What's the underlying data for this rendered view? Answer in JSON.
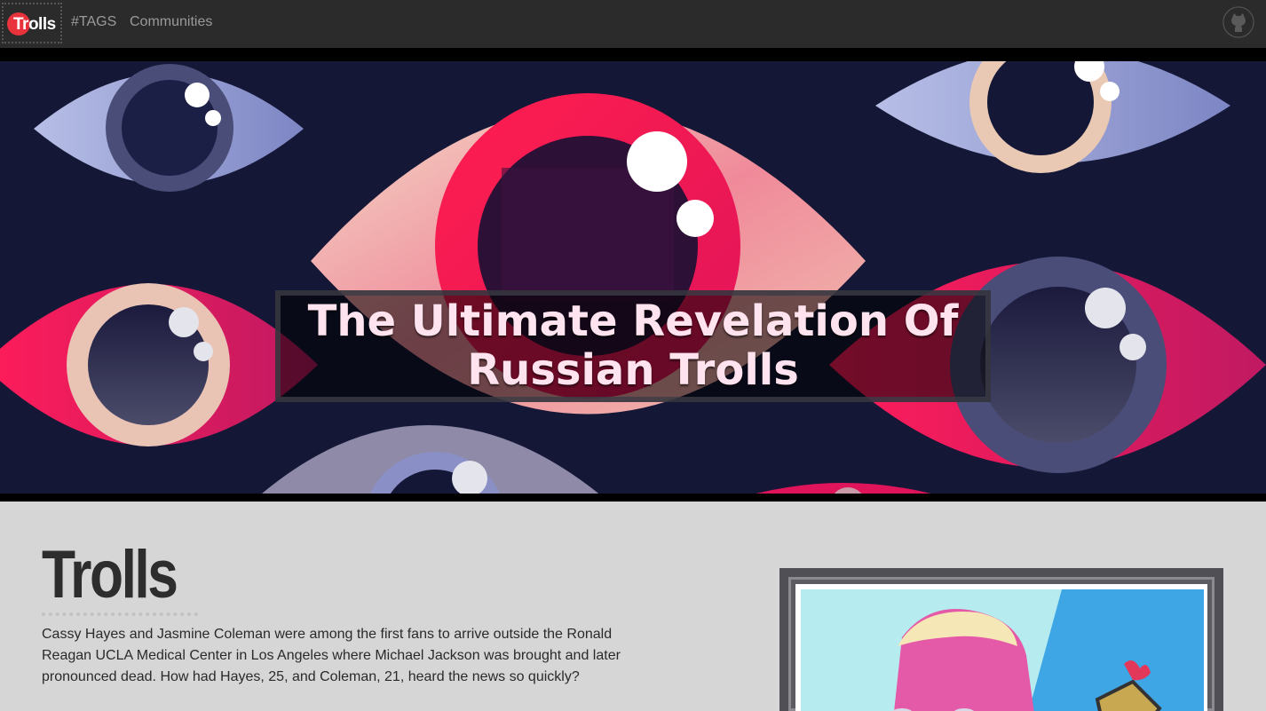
{
  "navbar": {
    "brand": "Trolls",
    "links": [
      "#TAGS",
      "Communities"
    ],
    "github_icon": "github-icon"
  },
  "hero": {
    "title": "The Ultimate Revelation Of Russian Trolls"
  },
  "content": {
    "title": "Trolls",
    "intro": "Cassy Hayes and Jasmine Coleman were among the first fans to arrive outside the Ronald Reagan UCLA Medical Center in Los Angeles where Michael Jackson was brought and later pronounced dead. How had Hayes, 25, and Coleman, 21, heard the news so quickly?"
  },
  "colors": {
    "navbar": "#2b2b2b",
    "hero_bg": "#141736",
    "accent_red": "#e8323c",
    "page_bg": "#d6d6d6"
  }
}
